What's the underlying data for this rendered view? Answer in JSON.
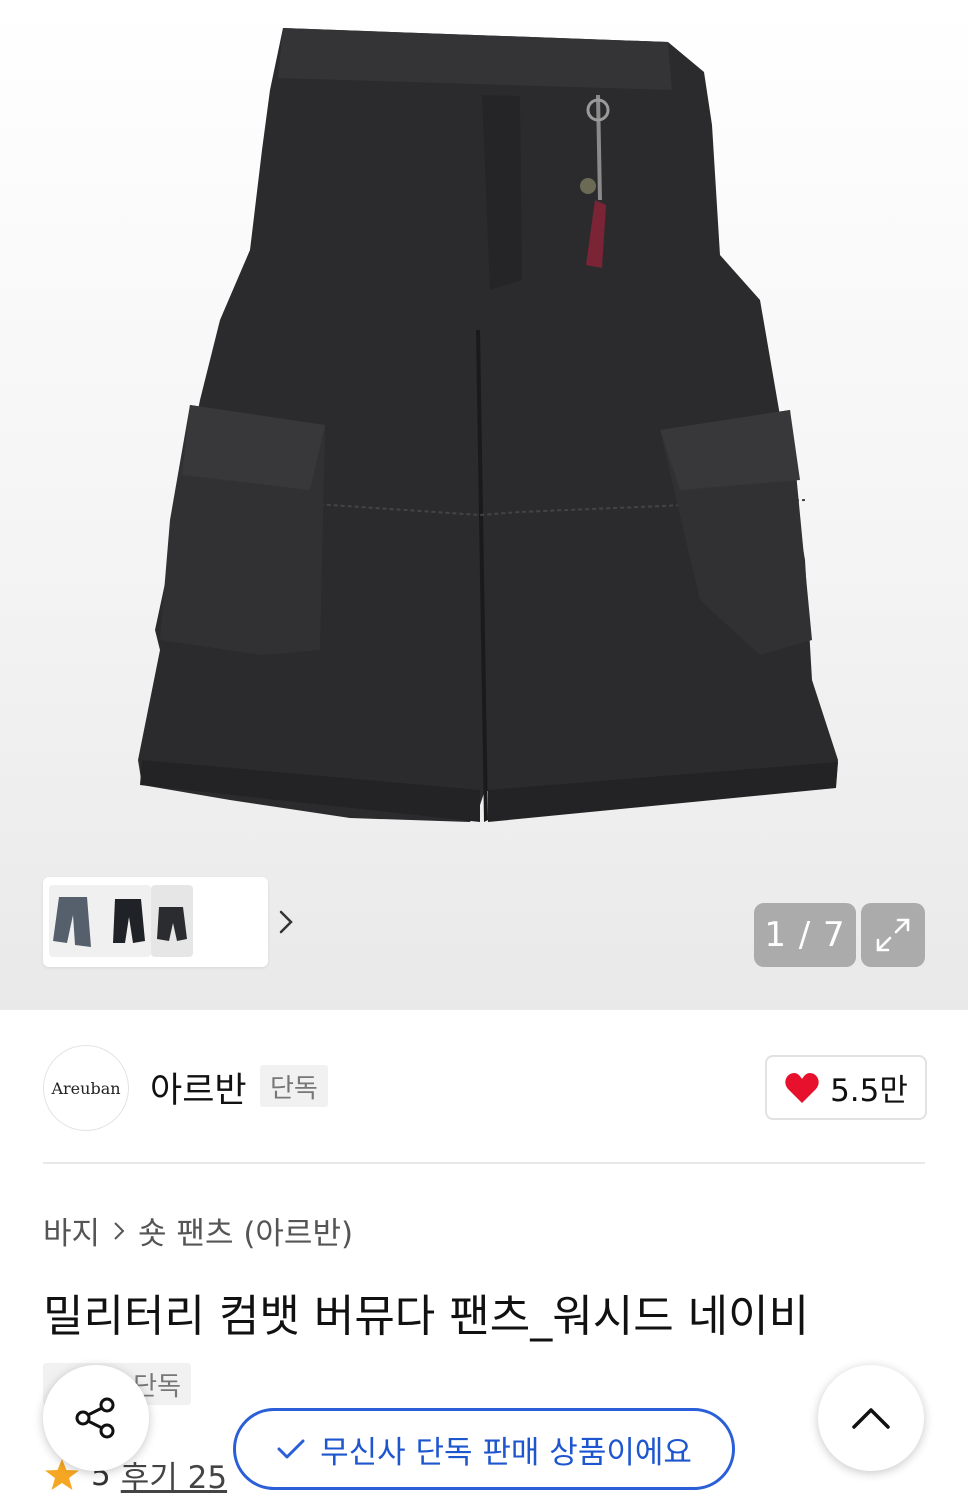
{
  "gallery": {
    "image_alt": "military combat bermuda pants",
    "counter": "1 / 7",
    "current_index": 1,
    "total_images": 7,
    "icons": {
      "next": "chevron-right-icon",
      "expand": "expand-arrows-icon"
    }
  },
  "brand": {
    "logo_text": "Areuban",
    "name": "아르반",
    "badge": "단독",
    "likes": "5.5만",
    "like_icon": "heart-icon",
    "like_color": "#e8112d"
  },
  "breadcrumb": {
    "category": "바지",
    "subcategory": "숏 팬츠 (아르반)"
  },
  "product": {
    "title": "밀리터리 컴뱃 버뮤다 팬츠_워시드 네이비",
    "exclusive_badge": "단독",
    "rating": "5",
    "review_label": "후기 25"
  },
  "floating": {
    "notice": "무신사 단독 판매 상품이에요",
    "notice_color": "#2a5fd8",
    "share_icon": "share-icon",
    "top_icon": "chevron-up-icon"
  }
}
